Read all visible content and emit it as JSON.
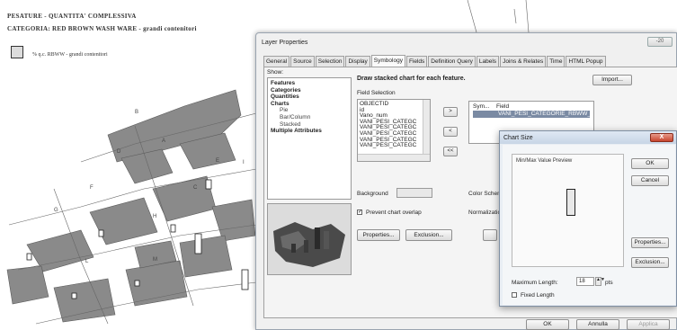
{
  "map": {
    "title": "PESATURE - QUANTITA' COMPLESSIVA",
    "category": "CATEGORIA: RED BROWN WASH WARE - grandi contenitori",
    "legend_label": "% q.c. RBWW - grandi contenitori",
    "sector_letters": [
      "A",
      "B",
      "C",
      "D",
      "E",
      "F",
      "G",
      "H",
      "I",
      "L",
      "M"
    ]
  },
  "layer_properties": {
    "title": "Layer Properties",
    "tabs": [
      "General",
      "Source",
      "Selection",
      "Display",
      "Symbology",
      "Fields",
      "Definition Query",
      "Labels",
      "Joins & Relates",
      "Time",
      "HTML Popup"
    ],
    "active_tab": "Symbology",
    "show_label": "Show:",
    "show_tree": [
      {
        "label": "Features",
        "bold": true,
        "sub": false
      },
      {
        "label": "Categories",
        "bold": true,
        "sub": false
      },
      {
        "label": "Quantities",
        "bold": true,
        "sub": false
      },
      {
        "label": "Charts",
        "bold": true,
        "sub": false
      },
      {
        "label": "Pie",
        "bold": false,
        "sub": true
      },
      {
        "label": "Bar/Column",
        "bold": false,
        "sub": true
      },
      {
        "label": "Stacked",
        "bold": false,
        "sub": true
      },
      {
        "label": "Multiple Attributes",
        "bold": true,
        "sub": false
      }
    ],
    "heading": "Draw stacked chart for each feature.",
    "import_button": "Import...",
    "field_selection_label": "Field Selection",
    "field_list": [
      "OBJECTID",
      "id",
      "Vano_num",
      "VANI_PESI_CATEGC",
      "VANI_PESI_CATEGC",
      "VANI_PESI_CATEGC",
      "VANI_PESI_CATEGC",
      "VANI_PESI_CATEGC"
    ],
    "arrow_buttons": [
      ">",
      "<",
      "<<"
    ],
    "sym_header": "Sym...",
    "field_header": "Field",
    "selected_field": "VANI_PESI_CATEGORIE_RBWW_",
    "background_label": "Background",
    "color_scheme_label": "Color Scheme",
    "prevent_overlap_label": "Prevent chart overlap",
    "normalization_label": "Normalization",
    "properties_button": "Properties...",
    "exclusion_button": "Exclusion...",
    "ok_button": "OK",
    "cancel_button": "Annulla",
    "apply_button": "Applica",
    "close_label": "-20"
  },
  "chart_size": {
    "title": "Chart Size",
    "close_glyph": "X",
    "preview_label": "Min/Max Value Preview",
    "ok_button": "OK",
    "cancel_button": "Cancel",
    "properties_button": "Properties...",
    "exclusion_button": "Exclusion...",
    "max_length_label": "Maximum Length:",
    "max_length_value": "18",
    "max_length_unit": "pts",
    "fixed_length_label": "Fixed Length"
  },
  "colors": {
    "building_fill": "#888888",
    "selection_highlight": "#7a8aa3",
    "close_red": "#c8452e"
  }
}
